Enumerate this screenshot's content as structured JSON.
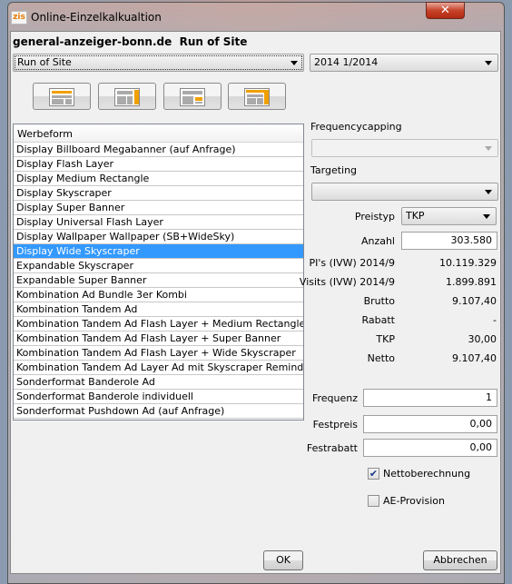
{
  "window": {
    "title": "Online-Einzelkalkualtion",
    "logo": "zis",
    "close_icon": "close-icon"
  },
  "header": {
    "title": "general-anzeiger-bonn.de  Run of Site"
  },
  "placement_select": {
    "value": "Run of Site"
  },
  "period_select": {
    "value": "2014 1/2014"
  },
  "layout_buttons": [
    "layout-billboard-icon",
    "layout-skyscraper-icon",
    "layout-medium-rectangle-icon",
    "layout-wallpaper-icon"
  ],
  "accent_color": "#f0a000",
  "list": {
    "header": "Werbeform",
    "selected_index": 7,
    "items": [
      "Display Billboard Megabanner (auf Anfrage)",
      "Display Flash Layer",
      "Display Medium Rectangle",
      "Display Skyscraper",
      "Display Super Banner",
      "Display Universal Flash Layer",
      "Display Wallpaper Wallpaper (SB+WideSky)",
      "Display Wide Skyscraper",
      "Expandable Skyscraper",
      "Expandable Super Banner",
      "Kombination Ad Bundle 3er Kombi",
      "Kombination Tandem Ad",
      "Kombination Tandem Ad Flash Layer + Medium Rectangle",
      "Kombination Tandem Ad Flash Layer + Super Banner",
      "Kombination Tandem Ad Flash Layer + Wide Skyscraper",
      "Kombination Tandem Ad Layer Ad mit Skyscraper Reminder",
      "Sonderformat Banderole Ad",
      "Sonderformat Banderole individuell",
      "Sonderformat Pushdown Ad (auf Anfrage)"
    ]
  },
  "form": {
    "frequencycapping_label": "Frequencycapping",
    "frequencycapping_value": "",
    "targeting_label": "Targeting",
    "targeting_value": "",
    "preistyp_label": "Preistyp",
    "preistyp_value": "TKP",
    "anzahl_label": "Anzahl",
    "anzahl_value": "303.580",
    "stats": [
      {
        "label": "PI's (IVW) 2014/9",
        "value": "10.119.329"
      },
      {
        "label": "Visits (IVW) 2014/9",
        "value": "1.899.891"
      },
      {
        "label": "Brutto",
        "value": "9.107,40"
      },
      {
        "label": "Rabatt",
        "value": "-"
      },
      {
        "label": "TKP",
        "value": "30,00"
      },
      {
        "label": "Netto",
        "value": "9.107,40"
      }
    ],
    "frequenz_label": "Frequenz",
    "frequenz_value": "1",
    "festpreis_label": "Festpreis",
    "festpreis_value": "0,00",
    "festrabatt_label": "Festrabatt",
    "festrabatt_value": "0,00",
    "nettoberechnung_label": "Nettoberechnung",
    "nettoberechnung_checked": true,
    "ae_provision_label": "AE-Provision",
    "ae_provision_checked": false
  },
  "buttons": {
    "ok": "OK",
    "cancel": "Abbrechen"
  }
}
